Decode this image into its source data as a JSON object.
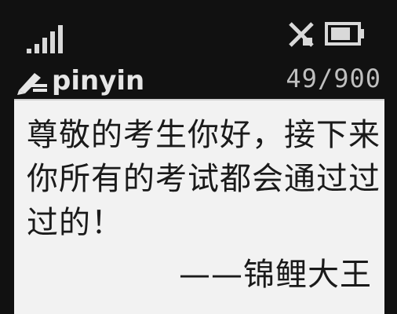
{
  "status_bar": {
    "signal_icon": "signal-strength-icon",
    "mute_icon": "mute-icon",
    "battery_icon": "battery-icon",
    "battery_level": 0.75
  },
  "input_mode": {
    "icon": "pen-icon",
    "label": "pinyin"
  },
  "char_count": "49/900",
  "message": {
    "body": "尊敬的考生你好，接下来你所有的考试都会通过过过的！",
    "signature": "——锦鲤大王"
  }
}
